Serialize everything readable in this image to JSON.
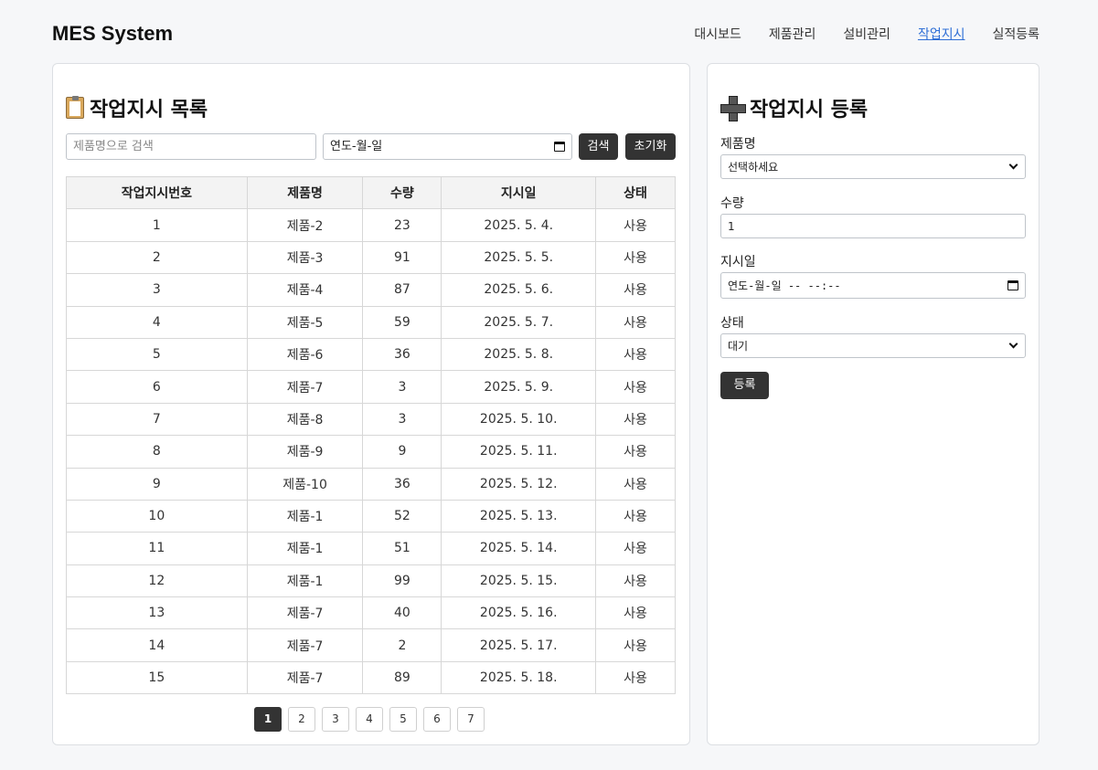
{
  "app": {
    "title": "MES System"
  },
  "nav": [
    {
      "label": "대시보드",
      "active": false
    },
    {
      "label": "제품관리",
      "active": false
    },
    {
      "label": "설비관리",
      "active": false
    },
    {
      "label": "작업지시",
      "active": true
    },
    {
      "label": "실적등록",
      "active": false
    }
  ],
  "list_panel": {
    "title": "작업지시 목록",
    "search": {
      "placeholder": "제품명으로 검색",
      "date_placeholder": "연도-월-일",
      "search_label": "검색",
      "reset_label": "초기화"
    },
    "columns": [
      "작업지시번호",
      "제품명",
      "수량",
      "지시일",
      "상태"
    ],
    "rows": [
      [
        "1",
        "제품-2",
        "23",
        "2025. 5. 4.",
        "사용"
      ],
      [
        "2",
        "제품-3",
        "91",
        "2025. 5. 5.",
        "사용"
      ],
      [
        "3",
        "제품-4",
        "87",
        "2025. 5. 6.",
        "사용"
      ],
      [
        "4",
        "제품-5",
        "59",
        "2025. 5. 7.",
        "사용"
      ],
      [
        "5",
        "제품-6",
        "36",
        "2025. 5. 8.",
        "사용"
      ],
      [
        "6",
        "제품-7",
        "3",
        "2025. 5. 9.",
        "사용"
      ],
      [
        "7",
        "제품-8",
        "3",
        "2025. 5. 10.",
        "사용"
      ],
      [
        "8",
        "제품-9",
        "9",
        "2025. 5. 11.",
        "사용"
      ],
      [
        "9",
        "제품-10",
        "36",
        "2025. 5. 12.",
        "사용"
      ],
      [
        "10",
        "제품-1",
        "52",
        "2025. 5. 13.",
        "사용"
      ],
      [
        "11",
        "제품-1",
        "51",
        "2025. 5. 14.",
        "사용"
      ],
      [
        "12",
        "제품-1",
        "99",
        "2025. 5. 15.",
        "사용"
      ],
      [
        "13",
        "제품-7",
        "40",
        "2025. 5. 16.",
        "사용"
      ],
      [
        "14",
        "제품-7",
        "2",
        "2025. 5. 17.",
        "사용"
      ],
      [
        "15",
        "제품-7",
        "89",
        "2025. 5. 18.",
        "사용"
      ]
    ],
    "pagination": {
      "pages": [
        "1",
        "2",
        "3",
        "4",
        "5",
        "6",
        "7"
      ],
      "current": "1"
    }
  },
  "form_panel": {
    "title": "작업지시 등록",
    "product_label": "제품명",
    "product_value": "선택하세요",
    "quantity_label": "수량",
    "quantity_value": "1",
    "date_label": "지시일",
    "date_placeholder": "연도-월-일 -- --:--",
    "status_label": "상태",
    "status_value": "대기",
    "submit_label": "등록"
  },
  "colors": {
    "accent": "#2f6fd6",
    "dark_button": "#333333",
    "background": "#f6f7f9"
  },
  "icons": [
    "clipboard-icon",
    "plus-icon",
    "calendar-icon",
    "chevron-down-icon"
  ]
}
